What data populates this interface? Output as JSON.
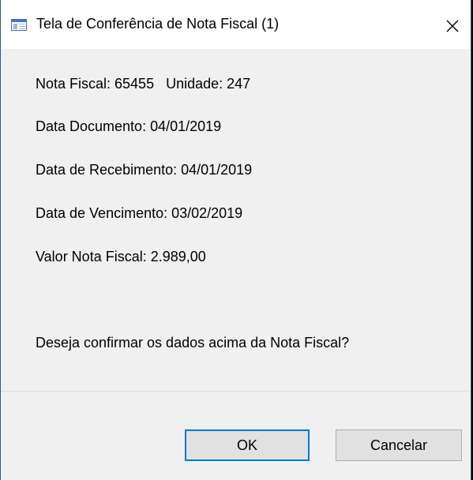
{
  "window": {
    "title": "Tela de Conferência de Nota Fiscal (1)",
    "close_glyph": "✕",
    "icon": "window-icon"
  },
  "info": {
    "nota_fiscal": "Nota Fiscal: 65455   Unidade: 247",
    "data_documento": "Data Documento: 04/01/2019",
    "data_recebimento": "Data de Recebimento: 04/01/2019",
    "data_vencimento": "Data de Vencimento: 03/02/2019",
    "valor": "Valor Nota Fiscal: 2.989,00"
  },
  "question": "Deseja confirmar os dados acima da Nota Fiscal?",
  "buttons": {
    "ok_label": "OK",
    "cancel_label": "Cancelar"
  },
  "colors": {
    "dialog_background": "#f0f0f0",
    "titlebar_background": "#ffffff",
    "default_button_border": "#0078d7",
    "window_border": "#2b5797"
  }
}
